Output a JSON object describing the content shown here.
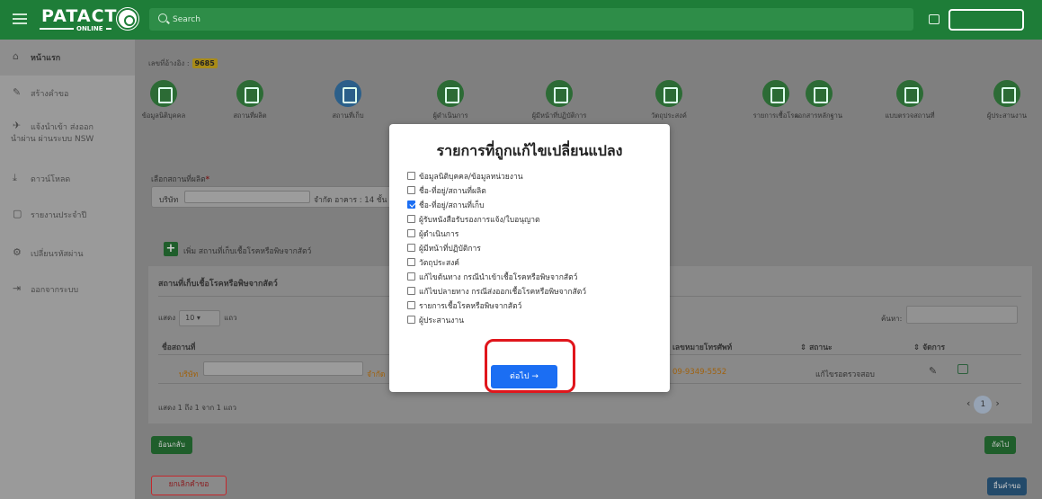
{
  "topbar": {
    "logo_main": "PATACT",
    "logo_sub": "ONLINE",
    "search_placeholder": "Search"
  },
  "sidebar": {
    "items": [
      {
        "icon": "home-icon",
        "glyph": "⌂",
        "label": "หน้าแรก",
        "active": true
      },
      {
        "icon": "pen-icon",
        "glyph": "✎",
        "label": "สร้างคำขอ"
      },
      {
        "icon": "airplane-icon",
        "glyph": "✈",
        "label": "แจ้งนำเข้า ส่งออก"
      },
      {
        "icon": "airplane-icon",
        "glyph": "",
        "label": "นำผ่าน ผ่านระบบ NSW"
      },
      {
        "icon": "download-icon",
        "glyph": "⤓",
        "label": "ดาวน์โหลด"
      },
      {
        "icon": "document-icon",
        "glyph": "▢",
        "label": "รายงานประจำปี"
      },
      {
        "icon": "gears-icon",
        "glyph": "⚙",
        "label": "เปลี่ยนรหัสผ่าน"
      },
      {
        "icon": "logout-icon",
        "glyph": "⇥",
        "label": "ออกจากระบบ"
      }
    ]
  },
  "reference": {
    "label": "เลขที่อ้างอิง :",
    "number": "9685"
  },
  "steps": [
    {
      "label": "ข้อมูลนิติบุคคล",
      "icon": "check-square-icon"
    },
    {
      "label": "สถานที่ผลิต",
      "icon": "building-icon"
    },
    {
      "label": "สถานที่เก็บ",
      "icon": "archive-icon",
      "active": true
    },
    {
      "label": "ผู้ดำเนินการ",
      "icon": "user-icon"
    },
    {
      "label": "ผู้มีหน้าที่ปฏิบัติการ",
      "icon": "users-icon"
    },
    {
      "label": "วัตถุประสงค์",
      "icon": "megaphone-icon"
    },
    {
      "label": "รายการเชื้อโรค",
      "icon": "virus-icon"
    },
    {
      "label": "เอกสารหลักฐาน",
      "icon": "file-icon"
    },
    {
      "label": "แบบตรวจสถานที่",
      "icon": "clipboard-icon"
    },
    {
      "label": "ผู้ประสานงาน",
      "icon": "contact-icon"
    }
  ],
  "form": {
    "select_label": "เลือกสถานที่ผลิต",
    "required_mark": "*",
    "select_prefix": "บริษัท",
    "select_suffix": "จำกัด อาคาร : 14 ชั้น : 5",
    "add_label": "เพิ่ม สถานที่เก็บเชื้อโรคหรือพิษจากสัตว์"
  },
  "table": {
    "title": "สถานที่เก็บเชื้อโรคหรือพิษจากสัตว์",
    "show_label": "แสดง",
    "show_value": "10",
    "rows_unit": "แถว",
    "search_label": "ค้นหา:",
    "headers": {
      "name": "ชื่อสถานที่",
      "phone": "เลขหมายโทรศัพท์",
      "status": "สถานะ",
      "manage": "จัดการ"
    },
    "rows": [
      {
        "name_prefix": "บริษัท",
        "name_suffix": "จำกัด",
        "phone": "09-9349-5552",
        "status": "แก้ไขรอตรวจสอบ"
      }
    ],
    "footer": "แสดง 1 ถึง 1 จาก 1 แถว",
    "page": "1"
  },
  "buttons": {
    "back": "ย้อนกลับ",
    "next": "ถัดไป",
    "cancel": "ยกเลิกคำขอ",
    "submit": "ยื่นคำขอ"
  },
  "modal": {
    "title": "รายการที่ถูกแก้ไขเปลี่ยนแปลง",
    "options": [
      {
        "label": "ข้อมูลนิติบุคคล/ข้อมูลหน่วยงาน",
        "checked": false
      },
      {
        "label": "ชื่อ-ที่อยู่/สถานที่ผลิต",
        "checked": false
      },
      {
        "label": "ชื่อ-ที่อยู่/สถานที่เก็บ",
        "checked": true
      },
      {
        "label": "ผู้รับหนังสือรับรองการแจ้ง/ใบอนุญาต",
        "checked": false
      },
      {
        "label": "ผู้ดำเนินการ",
        "checked": false
      },
      {
        "label": "ผู้มีหน้าที่ปฏิบัติการ",
        "checked": false
      },
      {
        "label": "วัตถุประสงค์",
        "checked": false
      },
      {
        "label": "แก้ไขต้นทาง กรณีนำเข้าเชื้อโรคหรือพิษจากสัตว์",
        "checked": false
      },
      {
        "label": "แก้ไขปลายทาง กรณีส่งออกเชื้อโรคหรือพิษจากสัตว์",
        "checked": false
      },
      {
        "label": "รายการเชื้อโรคหรือพิษจากสัตว์",
        "checked": false
      },
      {
        "label": "ผู้ประสานงาน",
        "checked": false
      }
    ],
    "next_button": "ต่อไป →"
  },
  "colors": {
    "brand_green": "#1e7d38",
    "primary_blue": "#1b6ef3",
    "highlight_red": "#e0161c"
  }
}
